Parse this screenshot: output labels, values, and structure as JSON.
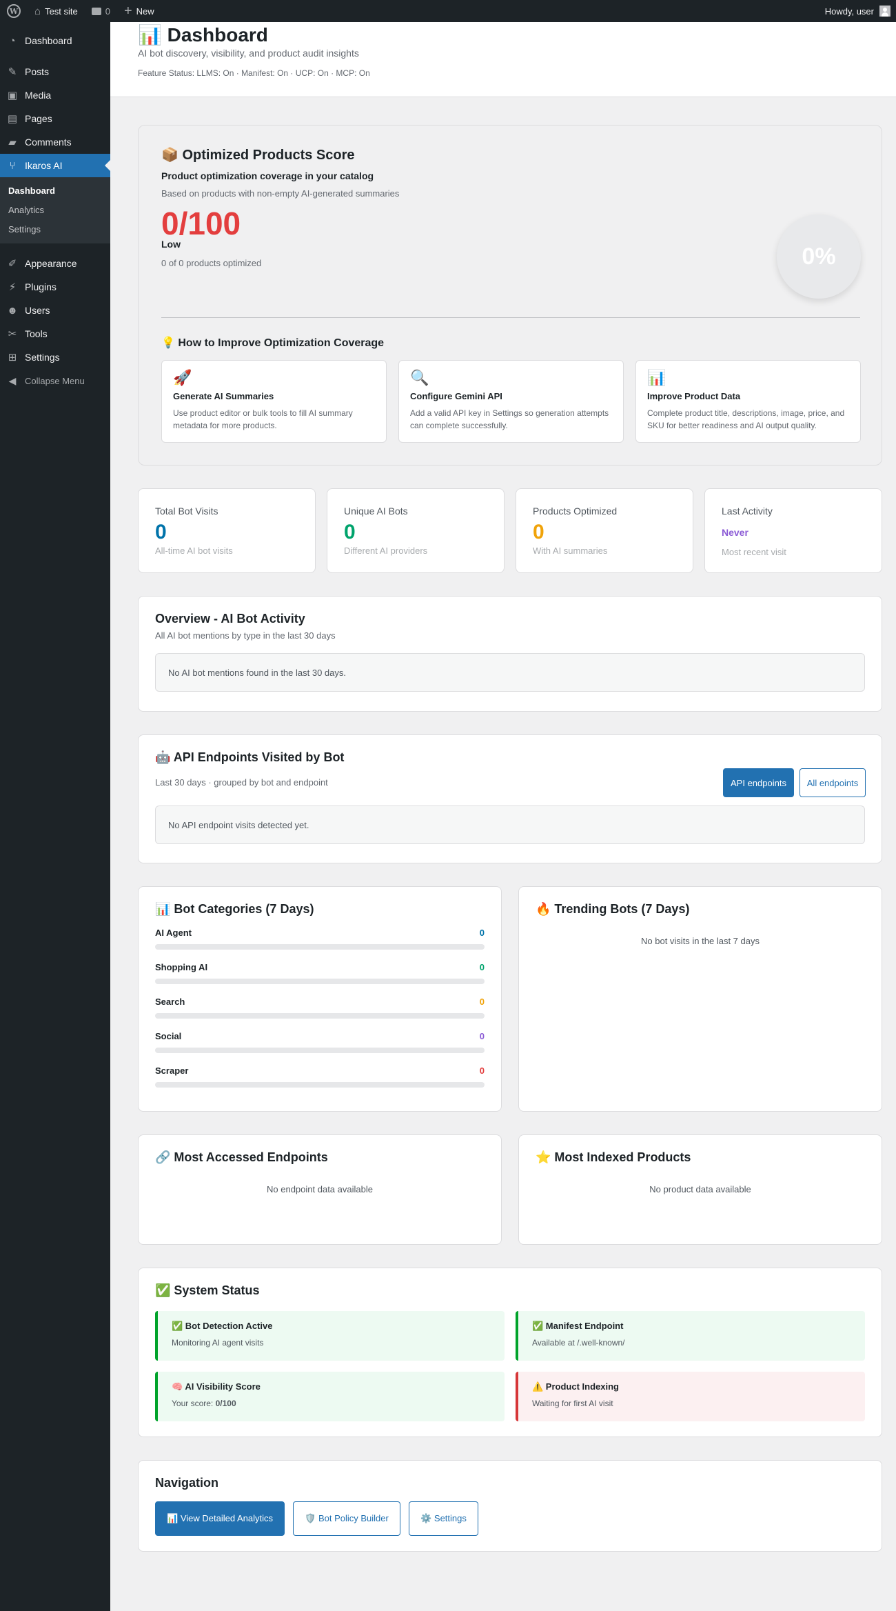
{
  "adminbar": {
    "logo": "W",
    "site_icon": "⌂",
    "site_name": "Test site",
    "comments_icon": "comment-icon",
    "comments_count": "0",
    "new_icon": "+",
    "new_label": "New",
    "howdy": "Howdy, user"
  },
  "sidebar": {
    "items": [
      {
        "label": "Dashboard",
        "icon": "◔"
      },
      {
        "label": "Posts",
        "icon": "✎"
      },
      {
        "label": "Media",
        "icon": "▣"
      },
      {
        "label": "Pages",
        "icon": "▤"
      },
      {
        "label": "Comments",
        "icon": "▰"
      },
      {
        "label": "Ikaros AI",
        "icon": "⑂"
      },
      {
        "label": "Appearance",
        "icon": "✐"
      },
      {
        "label": "Plugins",
        "icon": "⚡"
      },
      {
        "label": "Users",
        "icon": "☻"
      },
      {
        "label": "Tools",
        "icon": "✂"
      },
      {
        "label": "Settings",
        "icon": "⊞"
      }
    ],
    "submenu": [
      "Dashboard",
      "Analytics",
      "Settings"
    ],
    "collapse_label": "Collapse Menu",
    "collapse_icon": "◀"
  },
  "header": {
    "title": "📊 Dashboard",
    "subtitle": "AI bot discovery, visibility, and product audit insights",
    "feature_status": "Feature Status: LLMS: On · Manifest: On · UCP: On · MCP: On"
  },
  "score": {
    "title": "📦 Optimized Products Score",
    "tagline": "Product optimization coverage in your catalog",
    "based_on": "Based on products with non-empty AI-generated summaries",
    "value": "0/100",
    "level": "Low",
    "count_text": "0 of 0 products optimized",
    "percent": "0%",
    "improve_title": "💡 How to Improve Optimization Coverage",
    "tips": [
      {
        "icon": "🚀",
        "title": "Generate AI Summaries",
        "desc": "Use product editor or bulk tools to fill AI summary metadata for more products."
      },
      {
        "icon": "🔍",
        "title": "Configure Gemini API",
        "desc": "Add a valid API key in Settings so generation attempts can complete successfully."
      },
      {
        "icon": "📊",
        "title": "Improve Product Data",
        "desc": "Complete product title, descriptions, image, price, and SKU for better readiness and AI output quality."
      }
    ]
  },
  "stats": [
    {
      "label": "Total Bot Visits",
      "value": "0",
      "desc": "All-time AI bot visits",
      "color": "#0073aa"
    },
    {
      "label": "Unique AI Bots",
      "value": "0",
      "desc": "Different AI providers",
      "color": "#00a36c"
    },
    {
      "label": "Products Optimized",
      "value": "0",
      "desc": "With AI summaries",
      "color": "#f0a30a"
    },
    {
      "label": "Last Activity",
      "value": "Never",
      "desc": "Most recent visit",
      "color": "#8c5cd6"
    }
  ],
  "overview": {
    "title": "Overview - AI Bot Activity",
    "subtitle": "All AI bot mentions by type in the last 30 days",
    "empty": "No AI bot mentions found in the last 30 days."
  },
  "endpoints": {
    "title": "🤖 API Endpoints Visited by Bot",
    "subtitle": "Last 30 days · grouped by bot and endpoint",
    "btn_api": "API endpoints",
    "btn_all": "All endpoints",
    "empty": "No API endpoint visits detected yet."
  },
  "categories": {
    "title": "📊 Bot Categories (7 Days)",
    "rows": [
      {
        "label": "AI Agent",
        "value": "0",
        "color": "#0073aa",
        "fill": 0
      },
      {
        "label": "Shopping AI",
        "value": "0",
        "color": "#00a36c",
        "fill": 0
      },
      {
        "label": "Search",
        "value": "0",
        "color": "#f0a30a",
        "fill": 0
      },
      {
        "label": "Social",
        "value": "0",
        "color": "#8c5cd6",
        "fill": 0
      },
      {
        "label": "Scraper",
        "value": "0",
        "color": "#e33e3e",
        "fill": 0
      }
    ]
  },
  "trending": {
    "title": "🔥 Trending Bots (7 Days)",
    "empty": "No bot visits in the last 7 days"
  },
  "accessed": {
    "title": "🔗 Most Accessed Endpoints",
    "empty": "No endpoint data available"
  },
  "indexed": {
    "title": "⭐ Most Indexed Products",
    "empty": "No product data available"
  },
  "system": {
    "title": "✅ System Status",
    "items": [
      {
        "title": "✅ Bot Detection Active",
        "desc": "Monitoring AI agent visits",
        "status": "ok"
      },
      {
        "title": "✅ Manifest Endpoint",
        "desc": "Available at /.well-known/",
        "status": "ok"
      },
      {
        "title": "🧠 AI Visibility Score",
        "desc_prefix": "Your score: ",
        "desc_value": "0/100",
        "status": "ok"
      },
      {
        "title": "⚠️ Product Indexing",
        "desc": "Waiting for first AI visit",
        "status": "bad"
      }
    ]
  },
  "navigation": {
    "title": "Navigation",
    "analytics": "📊 View Detailed Analytics",
    "policy": "🛡️ Bot Policy Builder",
    "settings": "⚙️ Settings"
  }
}
